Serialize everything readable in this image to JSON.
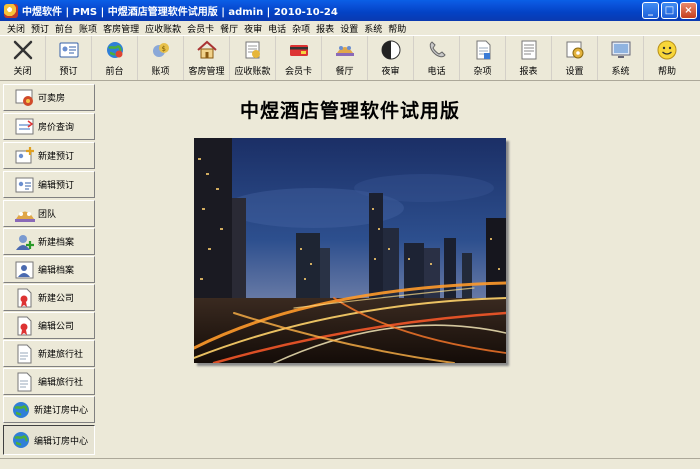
{
  "window": {
    "title": "中煜软件 | PMS | 中煜酒店管理软件试用版 | admin | 2010-10-24",
    "minimize": "_",
    "maximize": "□",
    "close": "×"
  },
  "menu": [
    "关闭",
    "预订",
    "前台",
    "账项",
    "客房管理",
    "应收账款",
    "会员卡",
    "餐厅",
    "夜审",
    "电话",
    "杂项",
    "报表",
    "设置",
    "系统",
    "帮助"
  ],
  "toolbar": [
    {
      "label": "关闭",
      "icon": "close-x-icon"
    },
    {
      "label": "预订",
      "icon": "reservation-card-icon"
    },
    {
      "label": "前台",
      "icon": "front-desk-globe-icon"
    },
    {
      "label": "账项",
      "icon": "accounts-icon"
    },
    {
      "label": "客房管理",
      "icon": "house-icon"
    },
    {
      "label": "应收账款",
      "icon": "receivables-icon"
    },
    {
      "label": "会员卡",
      "icon": "member-card-icon"
    },
    {
      "label": "餐厅",
      "icon": "restaurant-icon"
    },
    {
      "label": "夜审",
      "icon": "night-audit-moon-icon"
    },
    {
      "label": "电话",
      "icon": "phone-icon"
    },
    {
      "label": "杂项",
      "icon": "misc-document-icon"
    },
    {
      "label": "报表",
      "icon": "report-icon"
    },
    {
      "label": "设置",
      "icon": "settings-icon"
    },
    {
      "label": "系统",
      "icon": "system-monitor-icon"
    },
    {
      "label": "帮助",
      "icon": "smiley-help-icon"
    }
  ],
  "sidebar": [
    {
      "label": "可卖房",
      "icon": "available-room-icon"
    },
    {
      "label": "房价查询",
      "icon": "rate-query-icon"
    },
    {
      "label": "新建预订",
      "icon": "new-reservation-icon"
    },
    {
      "label": "编辑预订",
      "icon": "edit-reservation-icon"
    },
    {
      "label": "团队",
      "icon": "group-icon"
    },
    {
      "label": "新建档案",
      "icon": "new-profile-icon"
    },
    {
      "label": "编辑档案",
      "icon": "edit-profile-icon"
    },
    {
      "label": "新建公司",
      "icon": "new-company-icon"
    },
    {
      "label": "编辑公司",
      "icon": "edit-company-icon"
    },
    {
      "label": "新建旅行社",
      "icon": "new-travel-agency-icon"
    },
    {
      "label": "编辑旅行社",
      "icon": "edit-travel-agency-icon"
    },
    {
      "label": "新建订房中心",
      "icon": "new-booking-center-icon"
    },
    {
      "label": "编辑订房中心",
      "icon": "edit-booking-center-icon"
    }
  ],
  "main": {
    "title": "中煜酒店管理软件试用版"
  },
  "colors": {
    "titlebar": "#0A54DC",
    "face": "#ECE9D8"
  }
}
